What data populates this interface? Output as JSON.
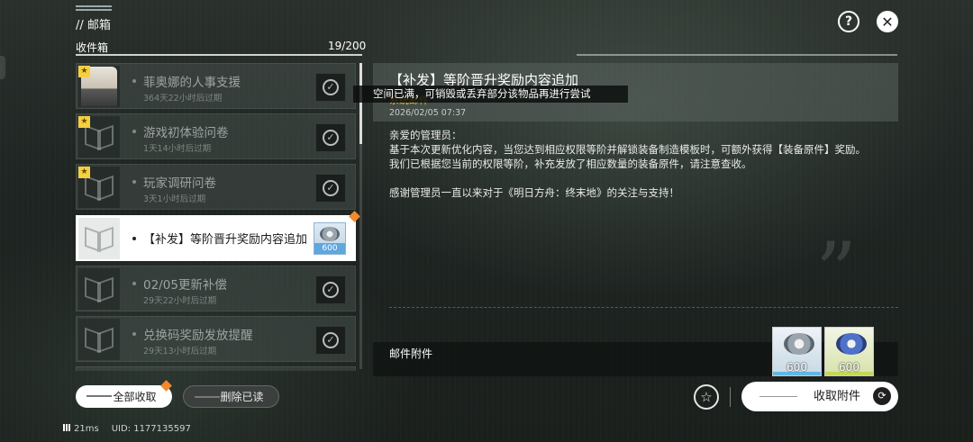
{
  "header": {
    "title": "// 邮箱"
  },
  "inbox": {
    "label": "收件箱",
    "count": "19/200",
    "items": [
      {
        "title": "菲奥娜的人事支援",
        "subtitle": "364天22小时后过期",
        "starred": true,
        "thumb": "avatar",
        "selected": false
      },
      {
        "title": "游戏初体验问卷",
        "subtitle": "1天14小时后过期",
        "starred": true,
        "thumb": "logo",
        "selected": false
      },
      {
        "title": "玩家调研问卷",
        "subtitle": "3天1小时后过期",
        "starred": true,
        "thumb": "logo",
        "selected": false
      },
      {
        "title": "【补发】等阶晋升奖励内容追加",
        "subtitle": "",
        "starred": false,
        "thumb": "logo",
        "selected": true,
        "attachment_count": "600"
      },
      {
        "title": "02/05更新补偿",
        "subtitle": "29天22小时后过期",
        "starred": false,
        "thumb": "logo",
        "selected": false
      },
      {
        "title": "兑换码奖励发放提醒",
        "subtitle": "29天13小时后过期",
        "starred": false,
        "thumb": "logo",
        "selected": false
      }
    ]
  },
  "toast": {
    "text": "空间已满，可销毁或丢弃部分该物品再进行尝试"
  },
  "mail": {
    "title": "【补发】等阶晋升奖励内容追加",
    "sender": "系统邮件",
    "date": "2026/02/05 07:37",
    "greeting": "亲爱的管理员：",
    "line1": "基于本次更新优化内容，当您达到相应权限等阶并解锁装备制造模板时，可额外获得【装备原件】奖励。",
    "line2": "我们已根据您当前的权限等阶，补充发放了相应数量的装备原件，请注意查收。",
    "line3": "感谢管理员一直以来对于《明日方舟：终末地》的关注与支持！",
    "attachments_label": "邮件附件",
    "attachments": [
      {
        "count": "600",
        "rarity_color": "#5fb8e6"
      },
      {
        "count": "600",
        "rarity_color": "#c6d65a"
      }
    ]
  },
  "buttons": {
    "collect_all": "全部收取",
    "delete_read": "删除已读",
    "collect_attachments": "收取附件"
  },
  "status": {
    "ping": "21ms",
    "uid": "UID: 1177135597"
  },
  "icons": {
    "help": "help-icon",
    "close": "close-icon",
    "star": "star-icon",
    "check": "check-circle-icon",
    "refresh": "collect-icon"
  }
}
